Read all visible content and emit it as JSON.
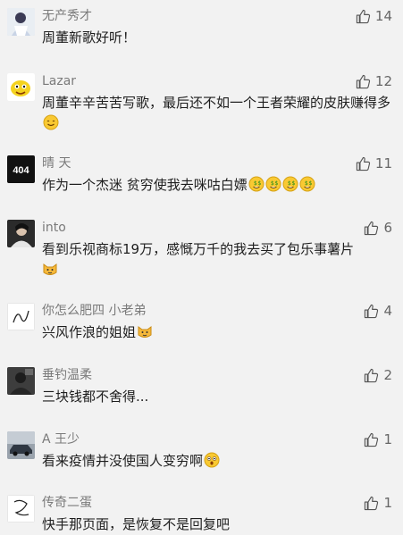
{
  "comments": [
    {
      "user": "无产秀才",
      "likes": "14",
      "text": "周董新歌好听！",
      "avatar_icon": "anime-girl-avatar-icon",
      "emojis": []
    },
    {
      "user": "Lazar",
      "likes": "12",
      "text": "周董辛辛苦苦写歌，最后还不如一个王者荣耀的皮肤赚得多",
      "avatar_icon": "yellow-cartoon-avatar-icon",
      "emojis": [
        "smile-emoji"
      ]
    },
    {
      "user": "晴 天",
      "likes": "11",
      "text": "作为一个杰迷 贫穷使我去咪咕白嫖",
      "avatar_icon": "404-avatar-icon",
      "avatar_text": "404",
      "emojis": [
        "money-emoji",
        "money-emoji",
        "money-emoji",
        "money-emoji"
      ]
    },
    {
      "user": "into",
      "likes": "6",
      "text": "看到乐视商标19万，感慨万千的我去买了包乐事薯片",
      "avatar_icon": "photo-avatar-icon",
      "emojis": [
        "cat-emoji"
      ]
    },
    {
      "user": "你怎么肥四 小老弟",
      "likes": "4",
      "text": "兴风作浪的姐姐",
      "avatar_icon": "sketch-avatar-icon",
      "emojis": [
        "cat-emoji"
      ]
    },
    {
      "user": "垂钓温柔",
      "likes": "2",
      "text": "三块钱都不舍得...",
      "avatar_icon": "dark-photo-avatar-icon",
      "emojis": []
    },
    {
      "user": "A 王少",
      "likes": "1",
      "text": "看来疫情并没使国人变穷啊",
      "avatar_icon": "car-photo-avatar-icon",
      "emojis": [
        "shocked-emoji"
      ]
    },
    {
      "user": "传奇二蛋",
      "likes": "1",
      "text": "快手那页面，是恢复不是回复吧",
      "avatar_icon": "sketch-avatar-icon-2",
      "emojis": []
    }
  ],
  "colors": {
    "background": "#f2f2f2",
    "username": "#7a7a7a",
    "text": "#1e1e1e",
    "like": "#666666"
  }
}
